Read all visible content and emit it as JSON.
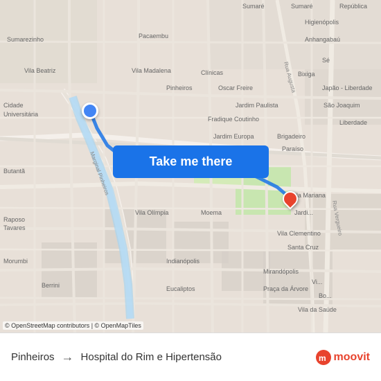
{
  "map": {
    "attribution": "© OpenStreetMap contributors | © OpenMapTiles",
    "action_button_label": "Take me there"
  },
  "bottom_bar": {
    "from_label": "Pinheiros",
    "arrow": "→",
    "to_label": "Hospital do Rim e Hipertensão",
    "brand_label": "moovit"
  },
  "pins": {
    "origin_label": "Pinheiros",
    "dest_label": "Hospital do Rim e Hipertensão"
  }
}
